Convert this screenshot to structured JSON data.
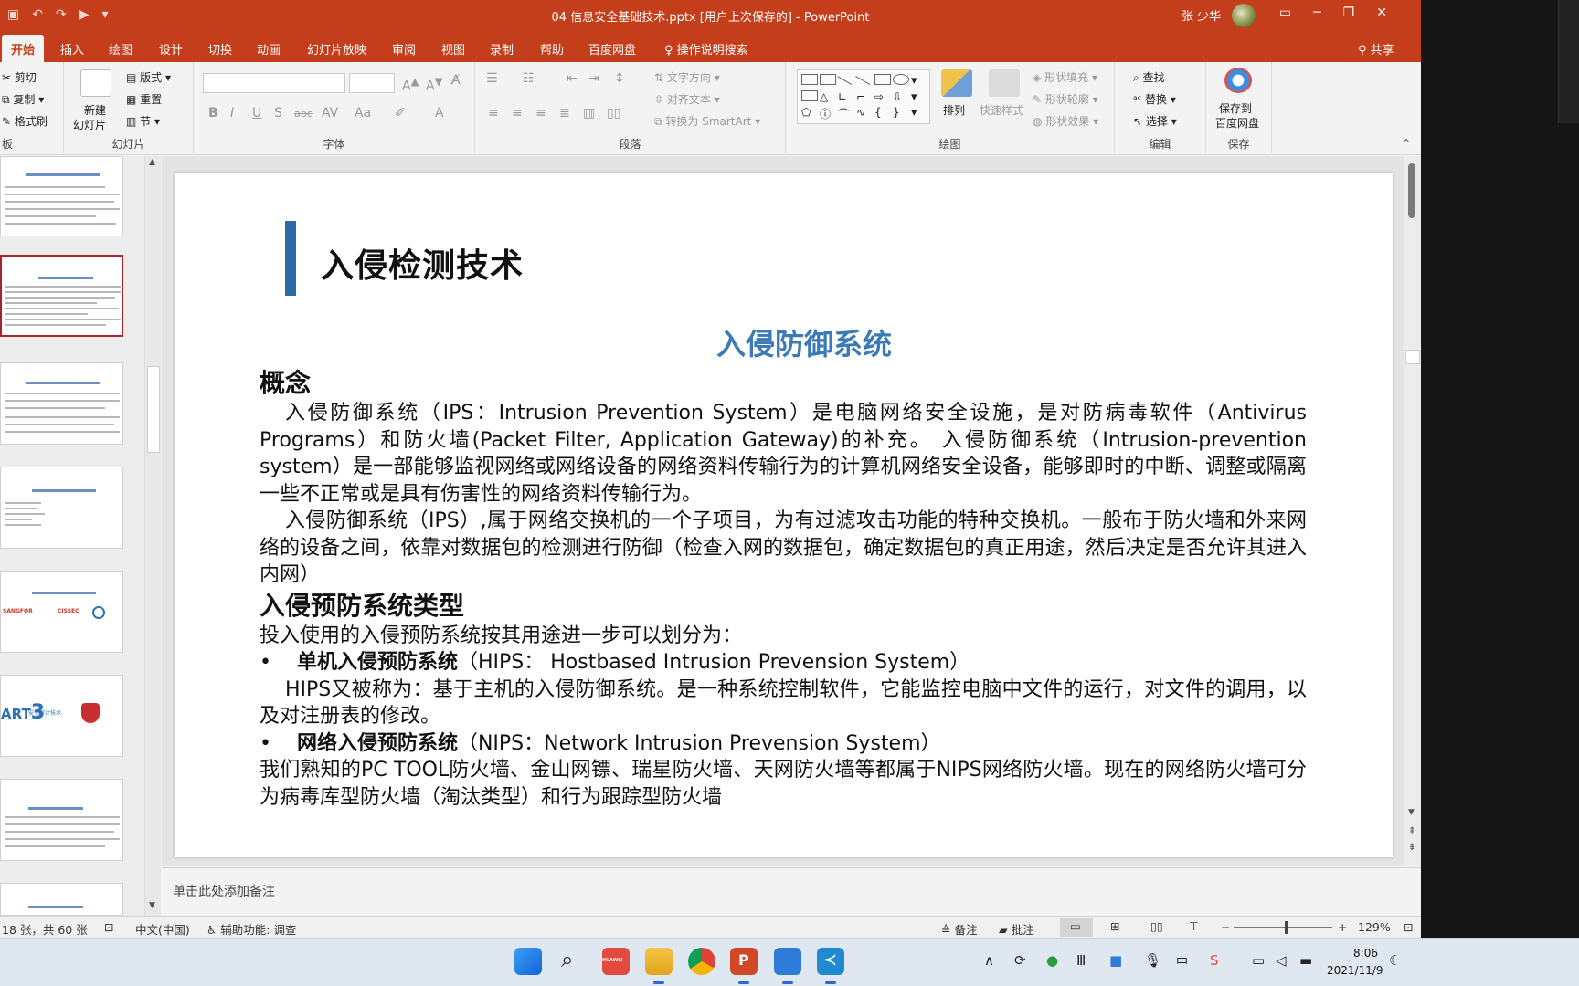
{
  "window": {
    "doc_title": "04 信息安全基础技术.pptx [用户上次保存的]  -  PowerPoint",
    "user_name": "张 少华",
    "qat_icons": [
      "save-icon",
      "undo-icon",
      "redo-icon",
      "present-icon",
      "customize-icon"
    ],
    "controls": [
      "ribbon-display-icon",
      "minimize-icon",
      "restore-icon",
      "close-icon"
    ]
  },
  "tabs": [
    "开始",
    "插入",
    "绘图",
    "设计",
    "切换",
    "动画",
    "幻灯片放映",
    "审阅",
    "视图",
    "录制",
    "帮助",
    "百度网盘"
  ],
  "active_tab": "开始",
  "tell_me": "操作说明搜索",
  "share": "共享",
  "ribbon": {
    "clipboard": {
      "cut": "剪切",
      "copy": "复制",
      "format_painter": "格式刷",
      "label": "板"
    },
    "slides": {
      "new_slide_line1": "新建",
      "new_slide_line2": "幻灯片",
      "layout": "版式",
      "reset": "重置",
      "section": "节",
      "label": "幻灯片"
    },
    "font": {
      "label": "字体"
    },
    "paragraph": {
      "text_direction": "文字方向",
      "align_text": "对齐文本",
      "smartart": "转换为 SmartArt",
      "label": "段落"
    },
    "drawing": {
      "arrange": "排列",
      "quick_styles": "快速样式",
      "shape_fill": "形状填充",
      "shape_outline": "形状轮廓",
      "shape_effects": "形状效果",
      "label": "绘图"
    },
    "editing": {
      "find": "查找",
      "replace": "替换",
      "select": "选择",
      "label": "编辑"
    },
    "save": {
      "line1": "保存到",
      "line2": "百度网盘",
      "label": "保存"
    }
  },
  "slide": {
    "title": "入侵检测技术",
    "subtitle": "入侵防御系统",
    "heading1": "概念",
    "p1": "入侵防御系统（IPS：Intrusion Prevention System）是电脑网络安全设施，是对防病毒软件（Antivirus Programs）和防火墙(Packet Filter, Application Gateway)的补充。 入侵防御系统（Intrusion-prevention system）是一部能够监视网络或网络设备的网络资料传输行为的计算机网络安全设备，能够即时的中断、调整或隔离一些不正常或是具有伤害性的网络资料传输行为。",
    "p2": "入侵防御系统（IPS）,属于网络交换机的一个子项目，为有过滤攻击功能的特种交换机。一般布于防火墙和外来网络的设备之间，依靠对数据包的检测进行防御（检查入网的数据包，确定数据包的真正用途，然后决定是否允许其进入内网）",
    "heading2": "入侵预防系统类型",
    "intro": "投入使用的入侵预防系统按其用途进一步可以划分为：",
    "b1_bold": "单机入侵预防系统",
    "b1_rest": "（HIPS： Hostbased Intrusion Prevension System）",
    "p3": "HIPS又被称为：基于主机的入侵防御系统。是一种系统控制软件，它能监控电脑中文件的运行，对文件的调用，以及对注册表的修改。",
    "b2_bold": "网络入侵预防系统",
    "b2_rest": "（NIPS：Network Intrusion Prevension System）",
    "p4": "我们熟知的PC TOOL防火墙、金山网镖、瑞星防火墙、天网防火墙等都属于NIPS网络防火墙。现在的网络防火墙可分为病毒库型防火墙（淘汰类型）和行为跟踪型防火墙"
  },
  "thumbnails": {
    "part_label": "ART",
    "part_number": "3",
    "part_sub": "安全审计技术",
    "logo_labels": [
      "SANGFOR",
      "CISSEC"
    ]
  },
  "notes_placeholder": "单击此处添加备注",
  "status": {
    "slide_count": "18 张，共 60 张",
    "language": "中文(中国)",
    "accessibility": "辅助功能: 调查",
    "notes": "备注",
    "comments": "批注",
    "zoom": "129%"
  },
  "taskbar": {
    "apps": [
      "start-icon",
      "search-icon",
      "huawei-icon",
      "file-explorer-icon",
      "chrome-icon",
      "powerpoint-icon",
      "feishu-icon",
      "vscode-icon"
    ],
    "huawei_label": "HUAWEI",
    "ime": "中",
    "time": "8:06",
    "date": "2021/11/9"
  },
  "colors": {
    "accent": "#c43e1c",
    "slide_title_bar": "#2e6aa7",
    "subtitle": "#3a7ab6"
  }
}
